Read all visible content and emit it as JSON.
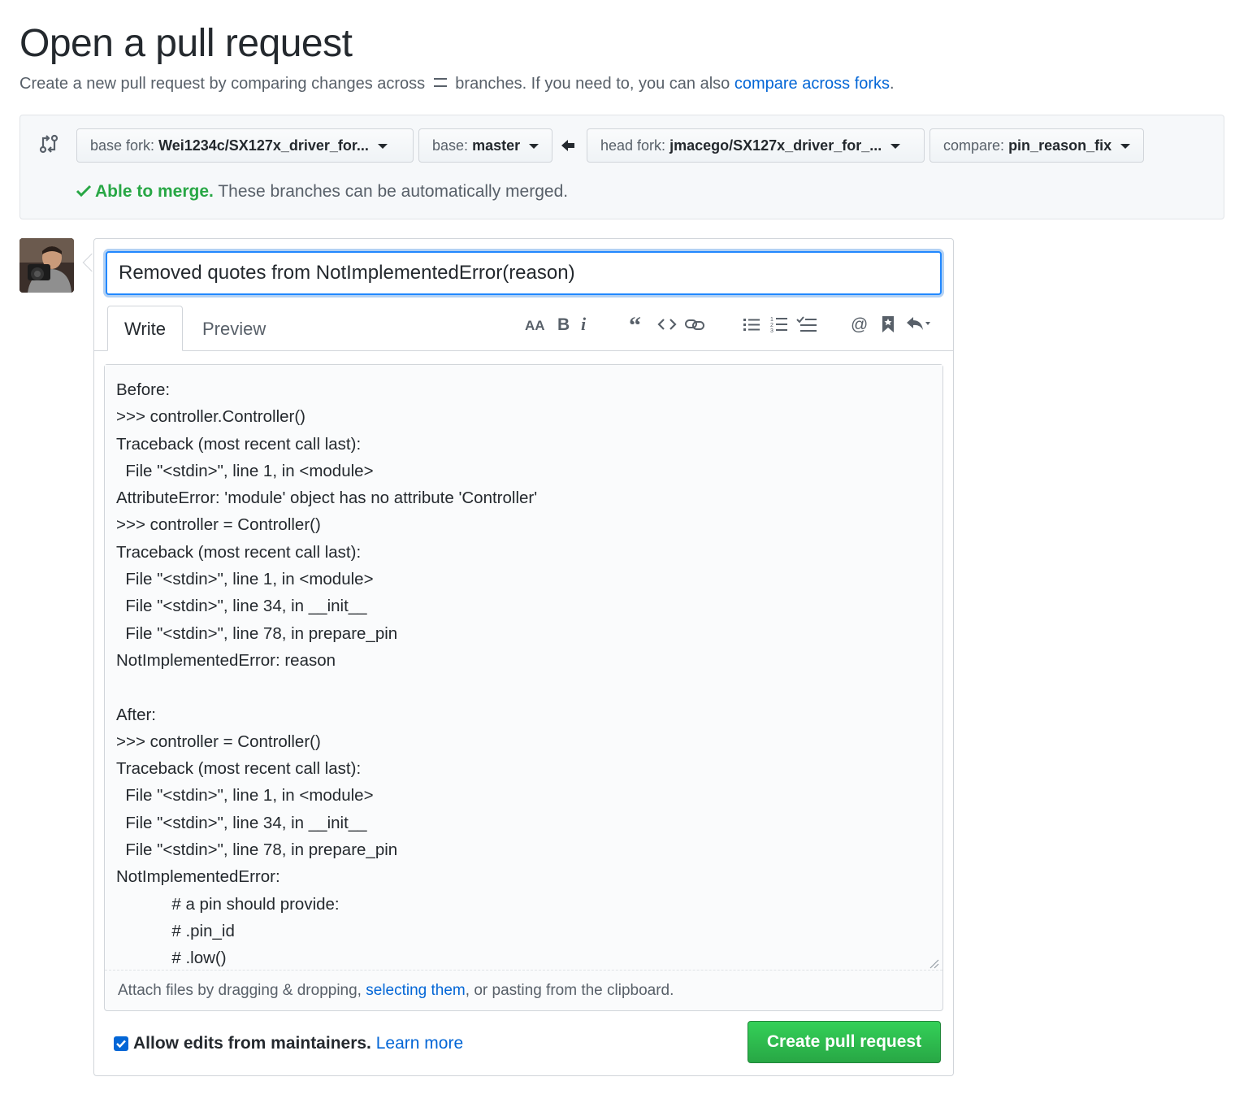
{
  "header": {
    "title": "Open a pull request",
    "subtitle_before": "Create a new pull request by comparing changes across",
    "subtitle_after": "branches. If you need to, you can also",
    "compare_link": "compare across forks",
    "subtitle_end": "."
  },
  "range": {
    "base_fork_label": "base fork:",
    "base_fork_value": "Wei1234c/SX127x_driver_for...",
    "base_label": "base:",
    "base_value": "master",
    "head_fork_label": "head fork:",
    "head_fork_value": "jmacego/SX127x_driver_for_...",
    "compare_label": "compare:",
    "compare_value": "pin_reason_fix",
    "merge_ok": "Able to merge.",
    "merge_text": "These branches can be automatically merged."
  },
  "composer": {
    "title_value": "Removed quotes from NotImplementedError(reason)",
    "tabs": [
      "Write",
      "Preview"
    ],
    "toolbar": [
      "header-icon",
      "bold-icon",
      "italic-icon",
      "quote-icon",
      "code-icon",
      "link-icon",
      "unordered-list-icon",
      "ordered-list-icon",
      "task-list-icon",
      "mention-icon",
      "saved-reply-icon",
      "reply-icon"
    ],
    "body": "Before:\n>>> controller.Controller()\nTraceback (most recent call last):\n  File \"<stdin>\", line 1, in <module>\nAttributeError: 'module' object has no attribute 'Controller'\n>>> controller = Controller()\nTraceback (most recent call last):\n  File \"<stdin>\", line 1, in <module>\n  File \"<stdin>\", line 34, in __init__\n  File \"<stdin>\", line 78, in prepare_pin\nNotImplementedError: reason\n\nAfter:\n>>> controller = Controller()\nTraceback (most recent call last):\n  File \"<stdin>\", line 1, in <module>\n  File \"<stdin>\", line 34, in __init__\n  File \"<stdin>\", line 78, in prepare_pin\nNotImplementedError:\n            # a pin should provide:\n            # .pin_id\n            # .low()",
    "attach_before": "Attach files by dragging & dropping,",
    "attach_link": "selecting them",
    "attach_after": ", or pasting from the clipboard.",
    "maintainers_label": "Allow edits from maintainers.",
    "learn_more": "Learn more",
    "create_button": "Create pull request"
  },
  "colors": {
    "accent": "#0366d6",
    "success": "#28a745",
    "focus_ring": "#2188ff"
  }
}
